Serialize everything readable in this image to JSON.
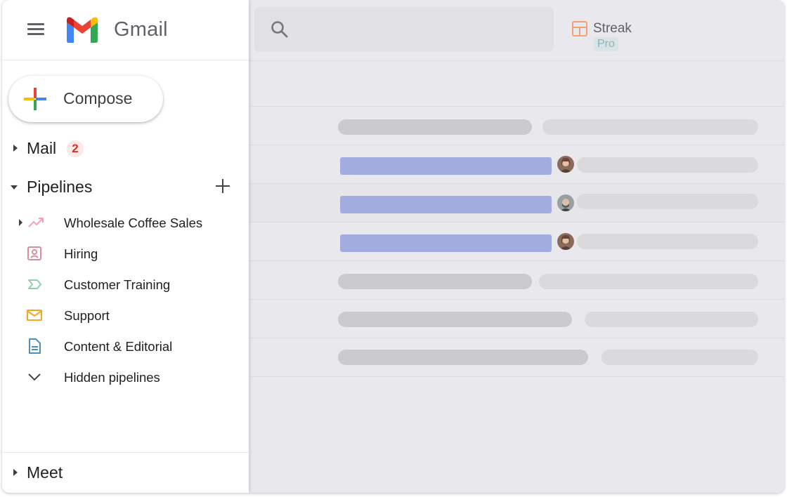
{
  "app": {
    "brand": "Gmail"
  },
  "compose": {
    "label": "Compose"
  },
  "sections": {
    "mail": {
      "label": "Mail",
      "badge": "2"
    },
    "pipelines": {
      "label": "Pipelines"
    },
    "meet": {
      "label": "Meet"
    }
  },
  "pipelines": [
    {
      "label": "Wholesale Coffee Sales",
      "icon": "trending-up-icon",
      "color": "#f4a0b5"
    },
    {
      "label": "Hiring",
      "icon": "badge-icon",
      "color": "#d98c9b"
    },
    {
      "label": "Customer Training",
      "icon": "chevron-tag-icon",
      "color": "#8fd0b0"
    },
    {
      "label": "Support",
      "icon": "envelope-icon",
      "color": "#f5a623"
    },
    {
      "label": "Content & Editorial",
      "icon": "document-icon",
      "color": "#4a90c2"
    },
    {
      "label": "Hidden pipelines",
      "icon": "chevron-down-icon",
      "color": "#444444"
    }
  ],
  "streak": {
    "name": "Streak",
    "tier": "Pro",
    "accent": "#f0a07a"
  },
  "colors": {
    "badge_bg": "#fce8e6",
    "badge_text": "#d93025",
    "highlight_bar": "#a3acdf"
  }
}
